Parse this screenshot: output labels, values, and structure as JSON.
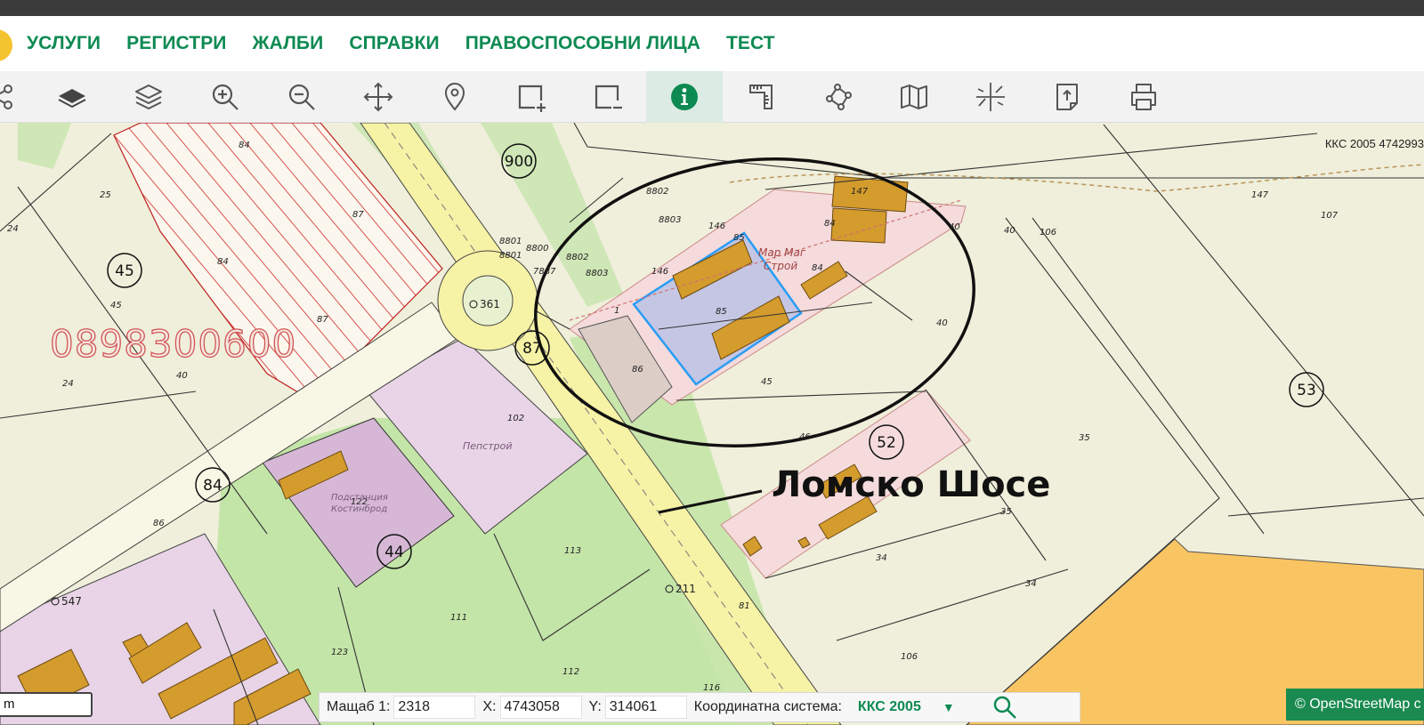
{
  "nav": {
    "items": [
      {
        "label": "УСЛУГИ"
      },
      {
        "label": "РЕГИСТРИ"
      },
      {
        "label": "ЖАЛБИ"
      },
      {
        "label": "СПРАВКИ"
      },
      {
        "label": "ПРАВОСПОСОБНИ ЛИЦА"
      },
      {
        "label": "ТЕСТ"
      }
    ]
  },
  "toolbar": {
    "tools": [
      {
        "icon": "share-icon"
      },
      {
        "icon": "layer-solid-icon"
      },
      {
        "icon": "layers-icon"
      },
      {
        "icon": "zoom-in-icon"
      },
      {
        "icon": "zoom-out-icon"
      },
      {
        "icon": "pan-icon"
      },
      {
        "icon": "location-pin-icon"
      },
      {
        "icon": "select-add-icon"
      },
      {
        "icon": "select-remove-icon"
      },
      {
        "icon": "info-icon",
        "active": true
      },
      {
        "icon": "measure-icon"
      },
      {
        "icon": "polygon-icon"
      },
      {
        "icon": "map-icon"
      },
      {
        "icon": "coordinates-icon"
      },
      {
        "icon": "export-icon"
      },
      {
        "icon": "print-icon"
      }
    ],
    "colors": {
      "accent": "#0d8a52",
      "icon": "#555555"
    }
  },
  "map": {
    "coord_system_label": "ККС 2005 4742993",
    "phone_watermark": "0898300600",
    "street_annotation": "Ломско Шосе",
    "region_numbers": [
      "900",
      "45",
      "87",
      "84",
      "44",
      "52",
      "53"
    ],
    "place_labels": {
      "shop": "Мар Маг Строй",
      "substation": "Подстанция Костинброд",
      "pepstroy": "Пепстрой"
    },
    "point_labels": [
      "361",
      "547",
      "211"
    ],
    "parcel_labels": [
      "84",
      "25",
      "24",
      "87",
      "84",
      "45",
      "87",
      "24",
      "8802",
      "8803",
      "146",
      "85",
      "147",
      "84",
      "40",
      "40",
      "106",
      "107",
      "147",
      "8801",
      "8801",
      "8800",
      "7887",
      "8802",
      "8803",
      "146",
      "1",
      "85",
      "84",
      "86",
      "102",
      "45",
      "46",
      "40",
      "35",
      "40",
      "122",
      "86",
      "113",
      "111",
      "123",
      "112",
      "116",
      "81",
      "35",
      "34",
      "34",
      "106"
    ]
  },
  "scale_input": {
    "value": "m"
  },
  "status_bar": {
    "scale_label": "Мащаб 1:",
    "scale_value": "2318",
    "x_label": "X:",
    "x_value": "4743058",
    "y_label": "Y:",
    "y_value": "314061",
    "coord_system_label": "Координатна система:",
    "coord_system_value": "ККС 2005",
    "dropdown_glyph": "▼"
  },
  "osm": {
    "label": "© OpenStreetMap c"
  }
}
